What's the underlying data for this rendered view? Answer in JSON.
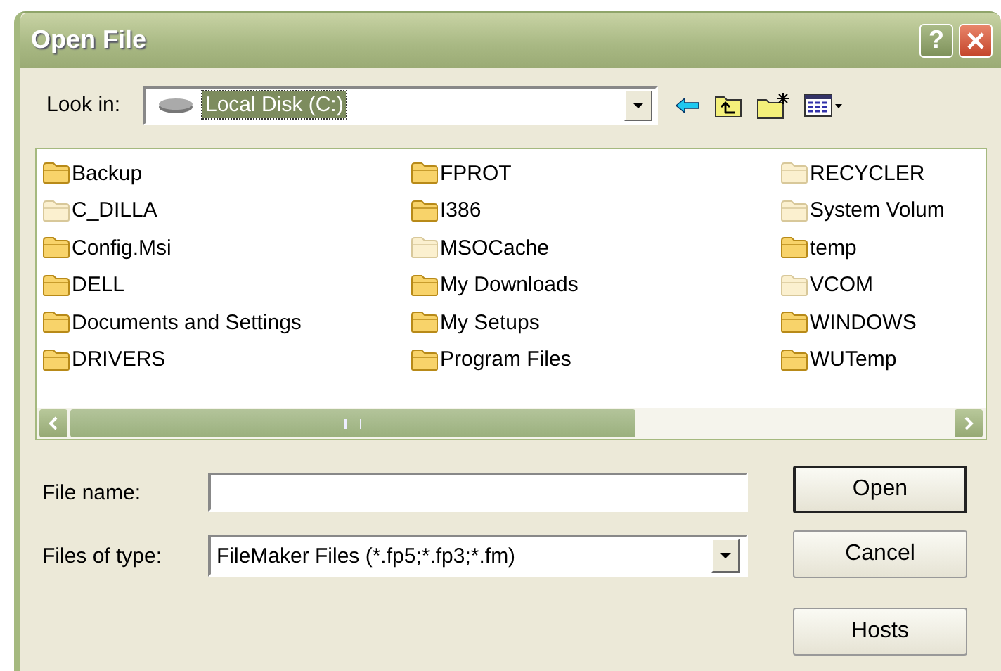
{
  "window": {
    "title": "Open File",
    "buttons": [
      {
        "kind": "help",
        "label": "?"
      },
      {
        "kind": "close"
      }
    ]
  },
  "look_in": {
    "label": "Look in:",
    "value": "Local Disk (C:)"
  },
  "toolbar": [
    {
      "kind": "back"
    },
    {
      "kind": "up"
    },
    {
      "kind": "new-folder"
    },
    {
      "kind": "views"
    }
  ],
  "files": [
    {
      "name": "Backup",
      "hidden": false
    },
    {
      "name": "C_DILLA",
      "hidden": true
    },
    {
      "name": "Config.Msi",
      "hidden": false
    },
    {
      "name": "DELL",
      "hidden": false
    },
    {
      "name": "Documents and Settings",
      "hidden": false
    },
    {
      "name": "DRIVERS",
      "hidden": false
    },
    {
      "name": "FPROT",
      "hidden": false
    },
    {
      "name": "I386",
      "hidden": false
    },
    {
      "name": "MSOCache",
      "hidden": true
    },
    {
      "name": "My Downloads",
      "hidden": false
    },
    {
      "name": "My Setups",
      "hidden": false
    },
    {
      "name": "Program Files",
      "hidden": false
    },
    {
      "name": "RECYCLER",
      "hidden": true
    },
    {
      "name": "System Volum",
      "hidden": true
    },
    {
      "name": "temp",
      "hidden": false
    },
    {
      "name": "VCOM",
      "hidden": true
    },
    {
      "name": "WINDOWS",
      "hidden": false
    },
    {
      "name": "WUTemp",
      "hidden": false
    }
  ],
  "file_name": {
    "label": "File name:"
  },
  "file_type": {
    "label": "Files of type:",
    "value": "FileMaker Files (*.fp5;*.fp3;*.fm)"
  },
  "buttons": [
    {
      "label": "Open",
      "default": true
    },
    {
      "label": "Cancel",
      "default": false
    },
    {
      "label": "Hosts",
      "default": false
    }
  ]
}
